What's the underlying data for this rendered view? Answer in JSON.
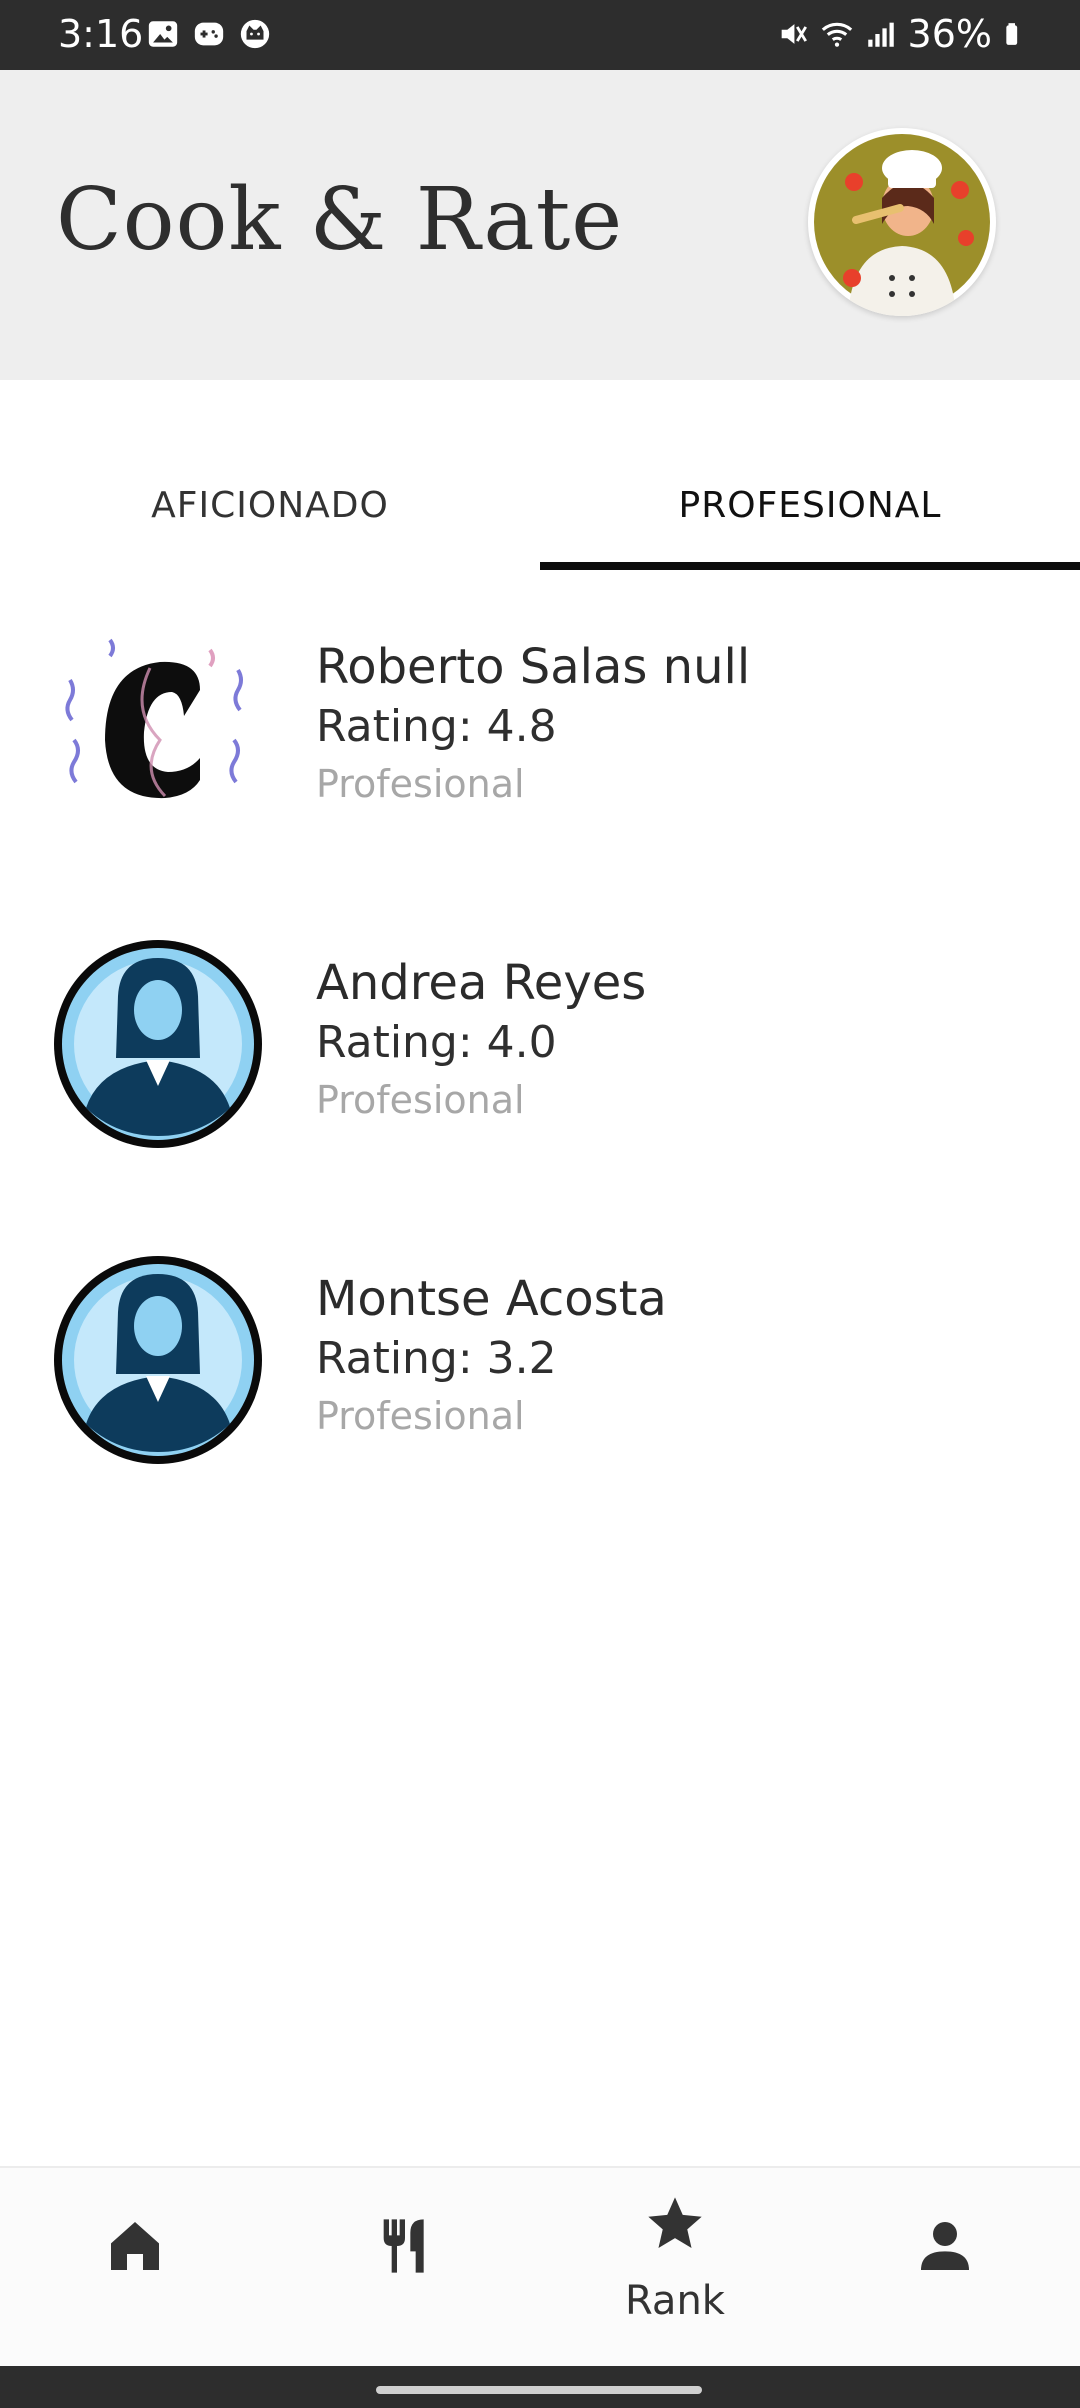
{
  "status_bar": {
    "time": "3:16",
    "battery": "36%",
    "icons": [
      "image-icon",
      "game-icon",
      "cat-face-icon",
      "mute-icon",
      "wifi-icon",
      "signal-icon",
      "battery-icon"
    ]
  },
  "header": {
    "title": "Cook & Rate",
    "avatar_icon": "chef-avatar-icon"
  },
  "tabs": [
    {
      "label": "AFICIONADO",
      "selected": false
    },
    {
      "label": "PROFESIONAL",
      "selected": true
    }
  ],
  "chefs": [
    {
      "name": "Roberto Salas null",
      "rating": "Rating: 4.8",
      "level": "Profesional",
      "avatar": "letter-c-avatar"
    },
    {
      "name": "Andrea Reyes",
      "rating": "Rating: 4.0",
      "level": "Profesional",
      "avatar": "woman-avatar"
    },
    {
      "name": "Montse Acosta",
      "rating": "Rating: 3.2",
      "level": "Profesional",
      "avatar": "woman-avatar"
    }
  ],
  "bottom_nav": [
    {
      "id": "home",
      "icon": "home-icon",
      "label": ""
    },
    {
      "id": "recipes",
      "icon": "fork-knife-icon",
      "label": ""
    },
    {
      "id": "rank",
      "icon": "star-icon",
      "label": "Rank",
      "selected": true
    },
    {
      "id": "profile",
      "icon": "person-icon",
      "label": ""
    }
  ],
  "colors": {
    "status_bar": "#2d2d2d",
    "header_bg": "#eeeeee",
    "tab_indicator": "#0c0c0c",
    "secondary_text": "#a7a7a7",
    "avatar_blue": "#8ccff0"
  }
}
